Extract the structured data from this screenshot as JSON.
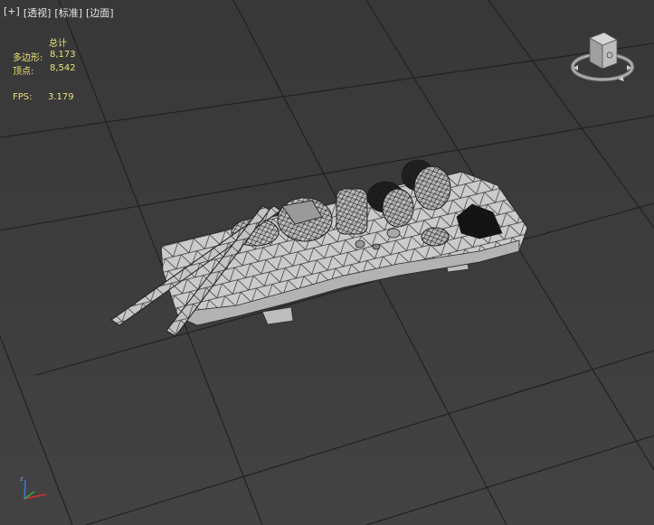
{
  "viewport": {
    "labels": [
      "[+]",
      "[透视]",
      "[标准]",
      "[边面]"
    ]
  },
  "stats": {
    "total_label": "总计",
    "polygons_label": "多边形:",
    "polygons_value": "8,173",
    "vertices_label": "顶点:",
    "vertices_value": "8,542",
    "fps_label": "FPS:",
    "fps_value": "3.179"
  },
  "colors": {
    "background": "#3b3b3b",
    "grid": "#1f1f1f",
    "stats_text": "#e8e27a",
    "label_text": "#e6e6e6",
    "model_fill": "#c9c9c9",
    "wire": "#2a2a2a"
  },
  "icons": {
    "viewcube": "viewcube-icon",
    "axis": "axis-tripod-icon"
  }
}
